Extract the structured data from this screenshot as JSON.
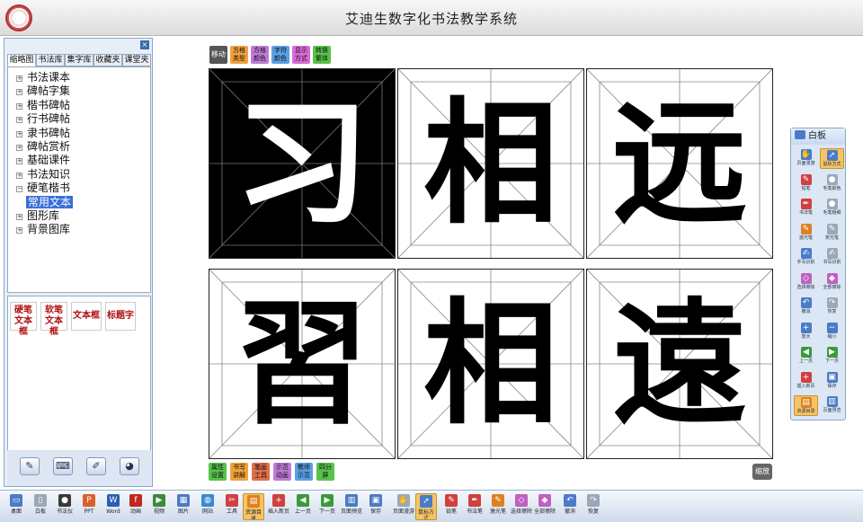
{
  "app": {
    "title": "艾迪生数字化书法教学系统"
  },
  "left_panel": {
    "close_label": "×",
    "tabs": [
      {
        "label": "缩略图"
      },
      {
        "label": "书法库"
      },
      {
        "label": "集字库"
      },
      {
        "label": "收藏夹"
      },
      {
        "label": "课堂夹"
      }
    ],
    "active_tab": 0,
    "tree": [
      {
        "label": "书法课本",
        "expander": "+"
      },
      {
        "label": "碑帖字集",
        "expander": "+"
      },
      {
        "label": "楷书碑帖",
        "expander": "+"
      },
      {
        "label": "行书碑帖",
        "expander": "+"
      },
      {
        "label": "隶书碑帖",
        "expander": "+"
      },
      {
        "label": "碑帖赏析",
        "expander": "+"
      },
      {
        "label": "基础课件",
        "expander": "+"
      },
      {
        "label": "书法知识",
        "expander": "+"
      },
      {
        "label": "硬笔楷书",
        "expander": "-"
      },
      {
        "label": "常用文本",
        "selected": true
      },
      {
        "label": "图形库",
        "expander": "+"
      },
      {
        "label": "背景图库",
        "expander": "+"
      }
    ],
    "text_boxes": [
      {
        "line1": "硬笔",
        "line2": "文本框"
      },
      {
        "line1": "软笔",
        "line2": "文本框"
      },
      {
        "line1": "文本框",
        "line2": ""
      },
      {
        "line1": "标题字",
        "line2": ""
      }
    ],
    "bottom_buttons": [
      {
        "icon": "brush-icon",
        "glyph": "✎"
      },
      {
        "icon": "keyboard-icon",
        "glyph": "⌨"
      },
      {
        "icon": "pen-tool-icon",
        "glyph": "✐"
      },
      {
        "icon": "color-palette-icon",
        "glyph": "◕"
      }
    ]
  },
  "top_tools": [
    {
      "label": "移动",
      "color": "#555555",
      "text_color": "#ffffff"
    },
    {
      "label": "方格类型",
      "color": "#f0a23a"
    },
    {
      "label": "方格颜色",
      "color": "#c07ad8"
    },
    {
      "label": "字符颜色",
      "color": "#5aa0e6"
    },
    {
      "label": "显示方式",
      "color": "#d86bd8"
    },
    {
      "label": "转换繁体",
      "color": "#58c24a"
    }
  ],
  "grid": {
    "row1": [
      {
        "char": "习",
        "inverted": true
      },
      {
        "char": "相"
      },
      {
        "char": "远"
      }
    ],
    "row2": [
      {
        "char": "習"
      },
      {
        "char": "相"
      },
      {
        "char": "遠"
      }
    ]
  },
  "bottom_tools": [
    {
      "label": "属性设置",
      "color": "#58c24a"
    },
    {
      "label": "书写讲解",
      "color": "#f0a23a"
    },
    {
      "label": "笔画工具",
      "color": "#e0704a"
    },
    {
      "label": "示范动画",
      "color": "#c07ad8"
    },
    {
      "label": "教师示范",
      "color": "#5aa0e6"
    },
    {
      "label": "四分屏",
      "color": "#58c24a"
    }
  ],
  "zoom_label": "缩放",
  "whiteboard": {
    "title": "白板",
    "items": [
      {
        "label": "页面漫游",
        "icon": "hand-icon",
        "color": "#4b7bc6",
        "glyph": "✋"
      },
      {
        "label": "鼠标方式",
        "icon": "cursor-icon",
        "color": "#4b7bc6",
        "glyph": "➚",
        "active": true
      },
      {
        "label": "铅笔",
        "icon": "pencil-icon",
        "color": "#d04040",
        "glyph": "✎"
      },
      {
        "label": "毛笔颜色",
        "icon": "brush-color-icon",
        "color": "#9aa8b8",
        "glyph": "●"
      },
      {
        "label": "书法笔",
        "icon": "calligraphy-pen-icon",
        "color": "#d04040",
        "glyph": "✒"
      },
      {
        "label": "毛笔粗细",
        "icon": "brush-size-icon",
        "color": "#9aa8b8",
        "glyph": "●"
      },
      {
        "label": "激光笔",
        "icon": "laser-pen-icon",
        "color": "#e08020",
        "glyph": "✎"
      },
      {
        "label": "荧光笔",
        "icon": "highlighter-icon",
        "color": "#9aa8b8",
        "glyph": "✎"
      },
      {
        "label": "手写识别",
        "icon": "handwriting-icon",
        "color": "#4b7bc6",
        "glyph": "✍"
      },
      {
        "label": "书写识别",
        "icon": "recognize-icon",
        "color": "#9aa8b8",
        "glyph": "✍"
      },
      {
        "label": "选择擦除",
        "icon": "eraser-icon",
        "color": "#c060c0",
        "glyph": "◇"
      },
      {
        "label": "全部擦除",
        "icon": "clear-all-icon",
        "color": "#c060c0",
        "glyph": "◆"
      },
      {
        "label": "撤消",
        "icon": "undo-icon",
        "color": "#4b7bc6",
        "glyph": "↶"
      },
      {
        "label": "恢复",
        "icon": "redo-icon",
        "color": "#9aa8b8",
        "glyph": "↷"
      },
      {
        "label": "放大",
        "icon": "zoom-in-icon",
        "color": "#4b7bc6",
        "glyph": "+"
      },
      {
        "label": "缩小",
        "icon": "zoom-out-icon",
        "color": "#4b7bc6",
        "glyph": "−"
      },
      {
        "label": "上一页",
        "icon": "prev-page-icon",
        "color": "#3a9a3a",
        "glyph": "◀"
      },
      {
        "label": "下一页",
        "icon": "next-page-icon",
        "color": "#3a9a3a",
        "glyph": "▶"
      },
      {
        "label": "插入新页",
        "icon": "insert-page-icon",
        "color": "#d04040",
        "glyph": "+"
      },
      {
        "label": "保存",
        "icon": "save-icon",
        "color": "#4b7bc6",
        "glyph": "▣"
      },
      {
        "label": "资源目录",
        "icon": "resource-dir-icon",
        "color": "#e08020",
        "glyph": "▤",
        "active": true
      },
      {
        "label": "页面预览",
        "icon": "page-preview-icon",
        "color": "#4b7bc6",
        "glyph": "▥"
      }
    ]
  },
  "taskbar": [
    {
      "label": "桌面",
      "icon": "desktop-icon",
      "color": "#4b7bc6",
      "glyph": "▭"
    },
    {
      "label": "白板",
      "icon": "whiteboard-icon",
      "color": "#9aa8b8",
      "glyph": "▯"
    },
    {
      "label": "书法仪",
      "icon": "camera-icon",
      "color": "#3a3a3a",
      "glyph": "●"
    },
    {
      "label": "PPT",
      "icon": "ppt-icon",
      "color": "#d9602a",
      "glyph": "P"
    },
    {
      "label": "Word",
      "icon": "word-icon",
      "color": "#2b5fb4",
      "glyph": "W"
    },
    {
      "label": "动画",
      "icon": "flash-icon",
      "color": "#c0281e",
      "glyph": "f"
    },
    {
      "label": "视频",
      "icon": "video-icon",
      "color": "#3a8a3a",
      "glyph": "▶"
    },
    {
      "label": "图片",
      "icon": "picture-icon",
      "color": "#4b7bc6",
      "glyph": "▦"
    },
    {
      "label": "网站",
      "icon": "globe-icon",
      "color": "#3a8ad0",
      "glyph": "◍"
    },
    {
      "label": "工具",
      "icon": "tools-icon",
      "color": "#d04040",
      "glyph": "✂"
    },
    {
      "label": "资源目录",
      "icon": "resource-dir-icon",
      "color": "#e08020",
      "glyph": "▤",
      "active": true
    },
    {
      "label": "插入新页",
      "icon": "insert-page-icon",
      "color": "#d04040",
      "glyph": "+"
    },
    {
      "label": "上一页",
      "icon": "prev-page-icon",
      "color": "#3a9a3a",
      "glyph": "◀"
    },
    {
      "label": "下一页",
      "icon": "next-page-icon",
      "color": "#3a9a3a",
      "glyph": "▶"
    },
    {
      "label": "页面预览",
      "icon": "page-preview-icon",
      "color": "#4b7bc6",
      "glyph": "▥"
    },
    {
      "label": "保存",
      "icon": "save-icon",
      "color": "#4b7bc6",
      "glyph": "▣"
    },
    {
      "label": "页面漫游",
      "icon": "hand-icon",
      "color": "#9aa8b8",
      "glyph": "✋"
    },
    {
      "label": "鼠标方式",
      "icon": "cursor-icon",
      "color": "#4b7bc6",
      "glyph": "➚",
      "active": true
    },
    {
      "label": "铅笔",
      "icon": "pencil-icon",
      "color": "#d04040",
      "glyph": "✎"
    },
    {
      "label": "书法笔",
      "icon": "calligraphy-pen-icon",
      "color": "#d04040",
      "glyph": "✒"
    },
    {
      "label": "激光笔",
      "icon": "laser-pen-icon",
      "color": "#e08020",
      "glyph": "✎"
    },
    {
      "label": "选择擦除",
      "icon": "eraser-icon",
      "color": "#c060c0",
      "glyph": "◇"
    },
    {
      "label": "全部擦除",
      "icon": "clear-all-icon",
      "color": "#c060c0",
      "glyph": "◆"
    },
    {
      "label": "撤消",
      "icon": "undo-icon",
      "color": "#4b7bc6",
      "glyph": "↶"
    },
    {
      "label": "恢复",
      "icon": "redo-icon",
      "color": "#9aa8b8",
      "glyph": "↷"
    }
  ]
}
